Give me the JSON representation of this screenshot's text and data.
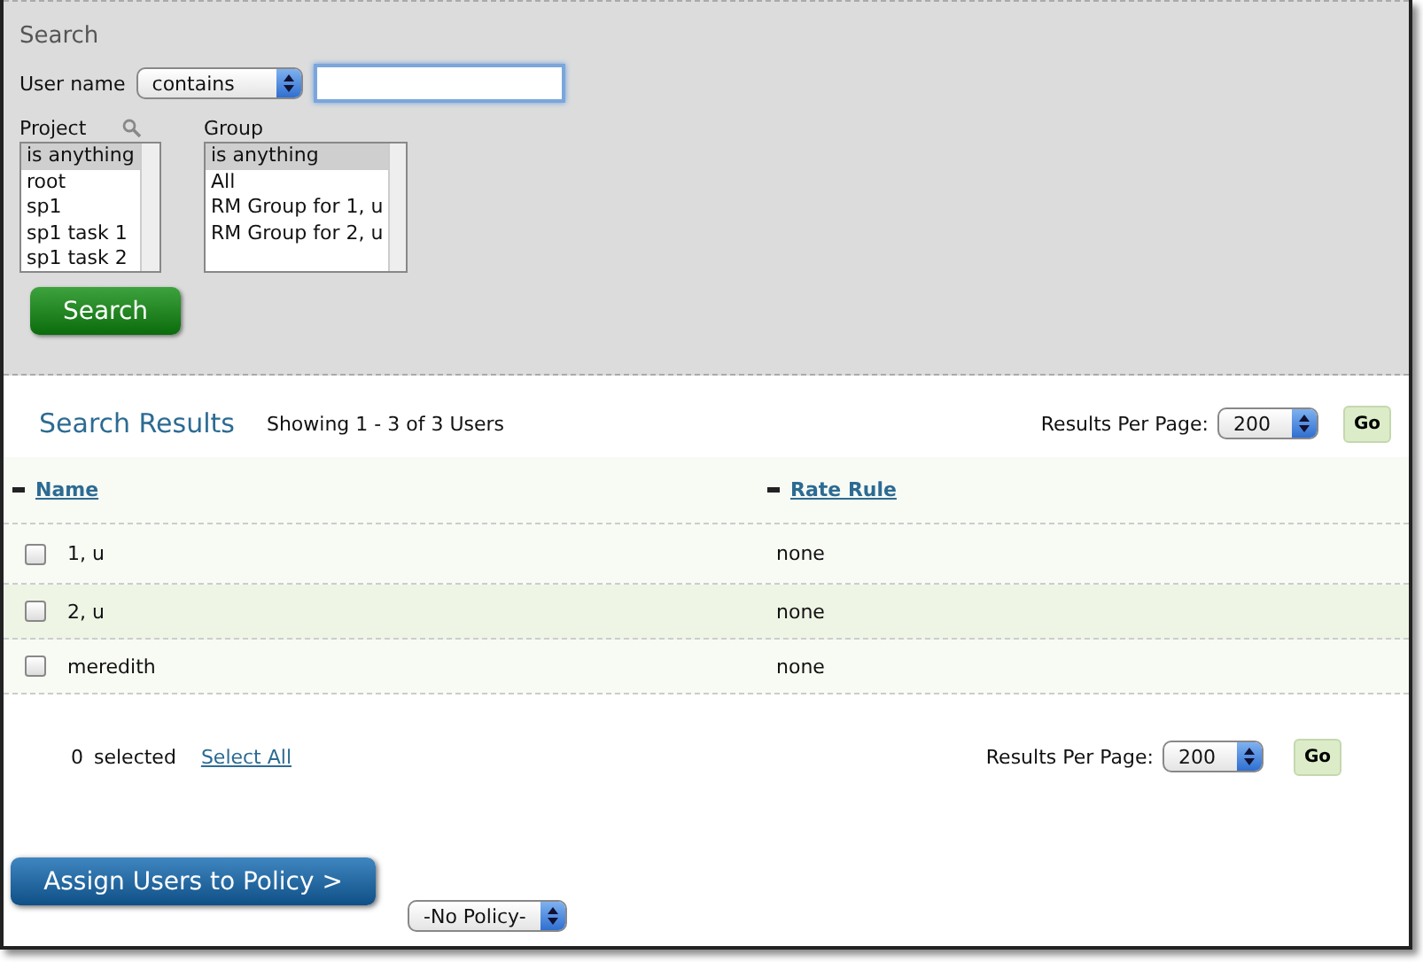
{
  "search": {
    "title": "Search",
    "user_name": {
      "label": "User name",
      "operator": "contains"
    },
    "project": {
      "label": "Project",
      "items": [
        {
          "label": "is anything",
          "selected": true
        },
        {
          "label": "root",
          "selected": false
        },
        {
          "label": "sp1",
          "selected": false
        },
        {
          "label": "sp1 task 1",
          "selected": false
        },
        {
          "label": "sp1 task 2",
          "selected": false
        }
      ]
    },
    "group": {
      "label": "Group",
      "items": [
        {
          "label": "is anything",
          "selected": true
        },
        {
          "label": "All",
          "selected": false
        },
        {
          "label": "RM Group for 1, u",
          "selected": false
        },
        {
          "label": "RM Group for 2, u",
          "selected": false
        }
      ]
    },
    "button": "Search"
  },
  "results": {
    "title": "Search Results",
    "summary": "Showing 1 - 3 of 3 Users",
    "per_page_label": "Results Per Page:",
    "per_page": "200",
    "go": "Go",
    "columns": [
      "Name",
      "Rate Rule"
    ],
    "rows": [
      {
        "name": "1, u",
        "rate_rule": "none",
        "checked": false
      },
      {
        "name": "2, u",
        "rate_rule": "none",
        "checked": false
      },
      {
        "name": "meredith",
        "rate_rule": "none",
        "checked": false
      }
    ]
  },
  "footer": {
    "selected_count": "0",
    "selected_label": "selected",
    "select_all": "Select All",
    "per_page_label": "Results Per Page:",
    "per_page": "200",
    "go": "Go"
  },
  "assign": {
    "button": "Assign Users to Policy >",
    "policy": "-No Policy-"
  }
}
